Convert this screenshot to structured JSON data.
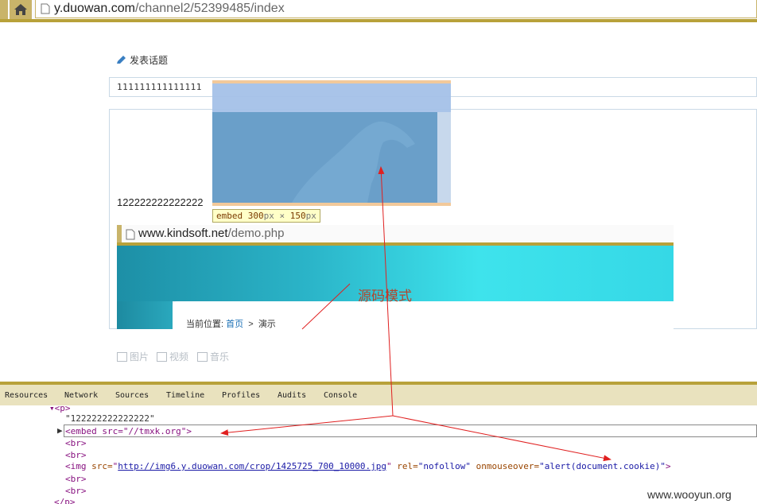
{
  "browser": {
    "url_host": "y.duowan.com",
    "url_path": "/channel2/52399485/index"
  },
  "editor": {
    "heading": "发表话题",
    "title_value": "111111111111111",
    "body_text": "122222222222222",
    "embed_tag": "embed",
    "embed_w": "300",
    "embed_h": "150",
    "px_unit": "px",
    "times": "×",
    "tools": [
      "图片",
      "视频",
      "音乐"
    ]
  },
  "nested": {
    "url_host": "www.kindsoft.net",
    "url_path": "/demo.php",
    "crumb_label": "当前位置:",
    "crumb_home": "首页",
    "crumb_sep": ">",
    "crumb_current": "演示"
  },
  "annotation": {
    "source_mode": "源码模式"
  },
  "devtools": {
    "tabs": [
      "Resources",
      "Network",
      "Sources",
      "Timeline",
      "Profiles",
      "Audits",
      "Console"
    ],
    "lines": {
      "p_open": "▾<p>",
      "text_node": "\"122222222222222\"",
      "embed_arrow": "▶",
      "embed": "<embed src=\"//tmxk.org\">",
      "br": "<br>",
      "img_open": "<img ",
      "img_src_attr": "src=",
      "img_src_val": "http://img6.y.duowan.com/crop/1425725_700_10000.jpg",
      "img_rel": " rel=",
      "img_rel_val": "\"nofollow\"",
      "img_onmouse": " onmouseover=",
      "img_onmouse_val": "\"alert(document.cookie)\"",
      "img_close": ">",
      "p_close": "</p>"
    }
  },
  "watermark": "www.wooyun.org",
  "colors": {
    "chrome_gold": "#b8a13a",
    "embed_highlight": "#a4c1e8",
    "arrow_red": "#e02020"
  }
}
